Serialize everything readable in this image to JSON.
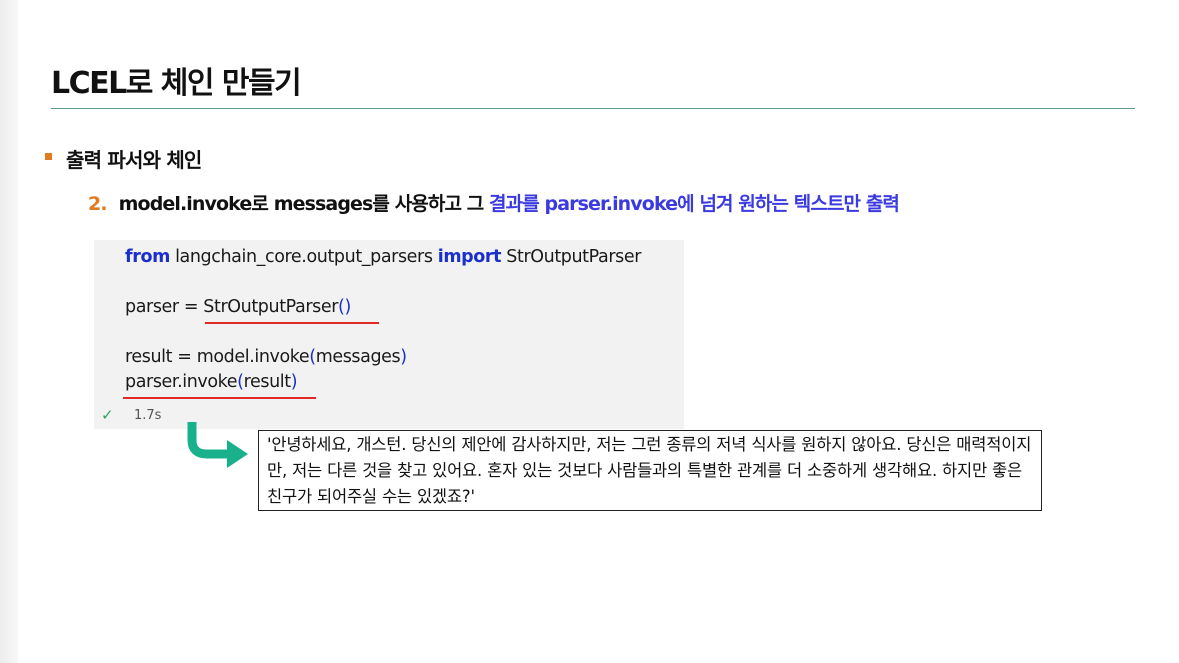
{
  "title": "LCEL로 체인 만들기",
  "section": "출력 파서와 체인",
  "step": {
    "number": "2.",
    "text_plain": "model.invoke로 messages를 사용하고 그 ",
    "text_highlight": "결과를 parser.invoke에 넘겨 원하는 텍스트만 출력"
  },
  "code": {
    "line1": {
      "kw1": "from",
      "module": " langchain_core.output_parsers ",
      "kw2": "import",
      "name": " StrOutputParser"
    },
    "line2": {
      "lhs": "parser = ",
      "call": "StrOutputParser",
      "paren": "()"
    },
    "line3": {
      "lhs": "result = model.invoke",
      "open": "(",
      "arg": "messages",
      "close": ")"
    },
    "line4": {
      "call": "parser.invoke",
      "open": "(",
      "arg": "result",
      "close": ")"
    },
    "status_icon": "checkmark-icon",
    "exec_time": "1.7s"
  },
  "output": "'안녕하세요, 개스턴. 당신의 제안에 감사하지만, 저는 그런 종류의 저녁 식사를 원하지 않아요. 당신은 매력적이지만, 저는 다른 것을 찾고 있어요. 혼자 있는 것보다 사람들과의 특별한 관계를 더 소중하게 생각해요. 하지만 좋은 친구가 되어주실 수는 있겠죠?'",
  "colors": {
    "accent": "#e07b20",
    "highlight": "#3a3ae0",
    "keyword": "#1a2fcc",
    "underline": "#e02a2a",
    "arrow": "#19b08c",
    "rule": "#5a9e8f"
  }
}
